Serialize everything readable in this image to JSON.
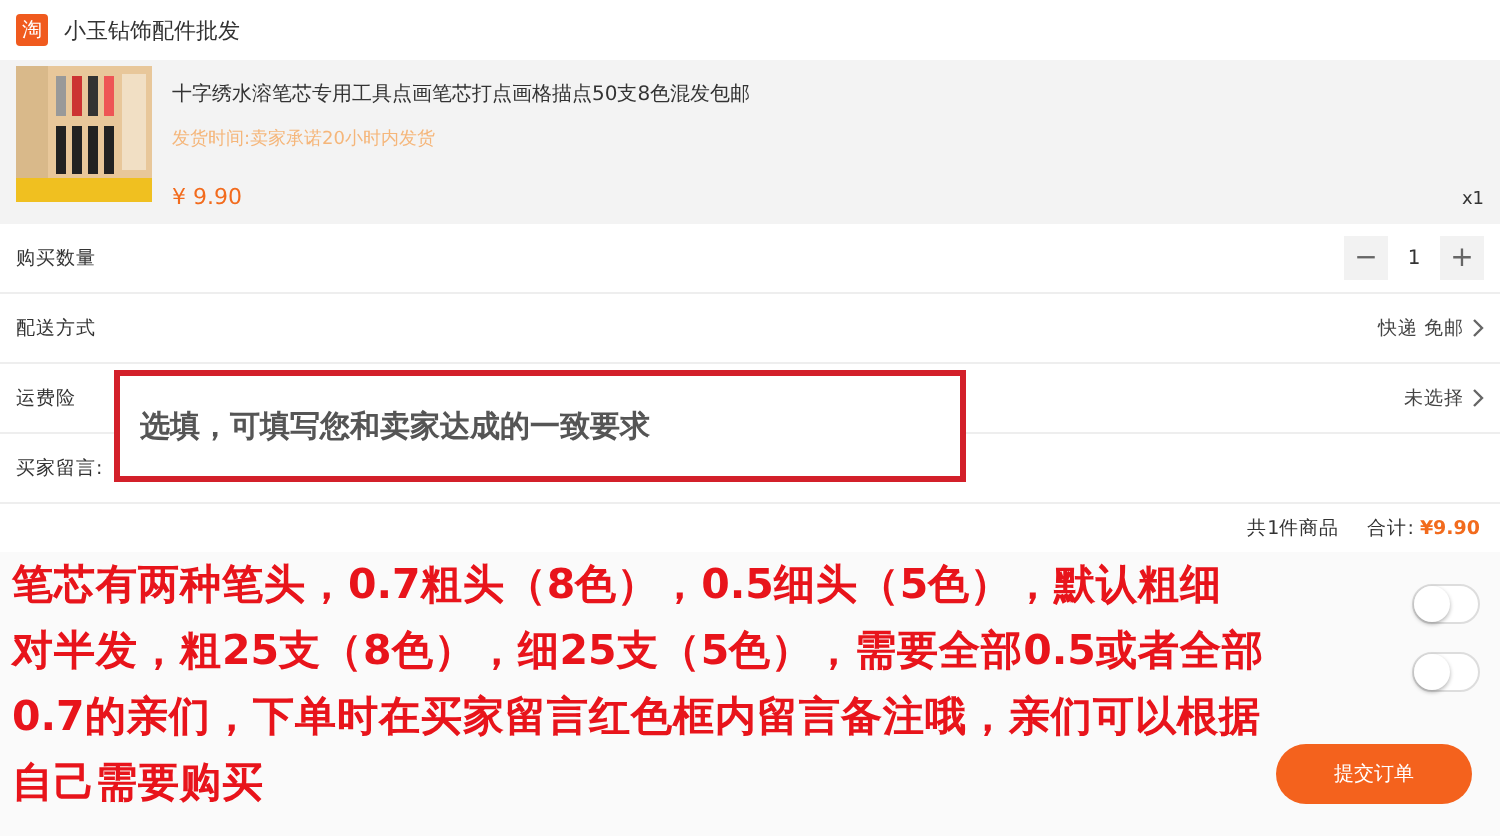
{
  "shop": {
    "icon": "淘",
    "name": "小玉钻饰配件批发"
  },
  "product": {
    "kind": "picture",
    "title": "十字绣水溶笔芯专用工具点画笔芯打点画格描点50支8色混发包邮",
    "shipping": "发货时间:卖家承诺20小时内发货",
    "price": "¥ 9.90",
    "count": "x1"
  },
  "quantity": {
    "label": "购买数量",
    "minus": "−",
    "value": "1",
    "plus": "+"
  },
  "rows": [
    {
      "label": "配送方式",
      "value": "快递 免邮"
    },
    {
      "label": "运费险",
      "value": "未选择"
    }
  ],
  "message": {
    "label": "买家留言:",
    "placeholder": "选填，可填写您和卖家达成的一致要求"
  },
  "summary": {
    "items": "共1件商品",
    "total_label": "合计:",
    "total": "¥9.90"
  },
  "toggles": [
    {
      "on": false
    },
    {
      "on": false
    }
  ],
  "annotation": "笔芯有两种笔头，0.7粗头（8色），0.5细头（5色），默认粗细对半发，粗25支（8色），细25支（5色），需要全部0.5或者全部0.7的亲们，下单时在买家留言红色框内留言备注哦，亲们可以根据自己需要购买",
  "submit": "提交订单"
}
